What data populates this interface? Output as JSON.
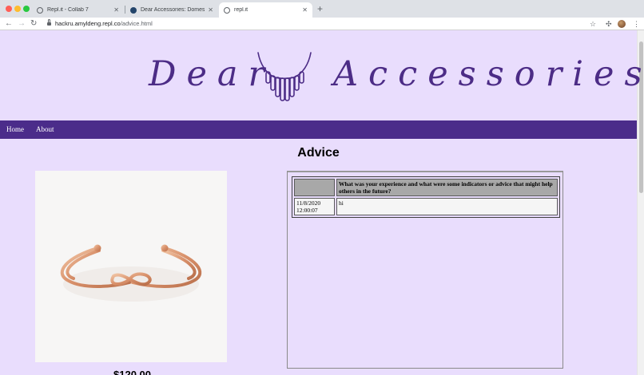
{
  "browser": {
    "tabs": [
      {
        "title": "Repl.it - Collab 7",
        "active": false
      },
      {
        "title": "Dear Accessories: Domestic A",
        "active": false
      },
      {
        "title": "repl.it",
        "active": true
      }
    ],
    "new_tab_label": "+",
    "url_host": "hackru.amyldeng.repl.co",
    "url_path": "/advice.html"
  },
  "header": {
    "brand_left": "Dear",
    "brand_right": "Accessories"
  },
  "nav": {
    "items": [
      {
        "label": "Home"
      },
      {
        "label": "About"
      }
    ]
  },
  "main": {
    "title": "Advice",
    "price": "$120.00"
  },
  "responses": {
    "headers": [
      "",
      "What was your experience and what were some indicators or advice that might help others in the future?"
    ],
    "rows": [
      {
        "timestamp": "11/8/2020 12:00:07",
        "answer": "hi"
      }
    ]
  },
  "colors": {
    "page_bg": "#e9ddfd",
    "nav_bg": "#4b2c8a",
    "brand": "#4c2c86"
  }
}
